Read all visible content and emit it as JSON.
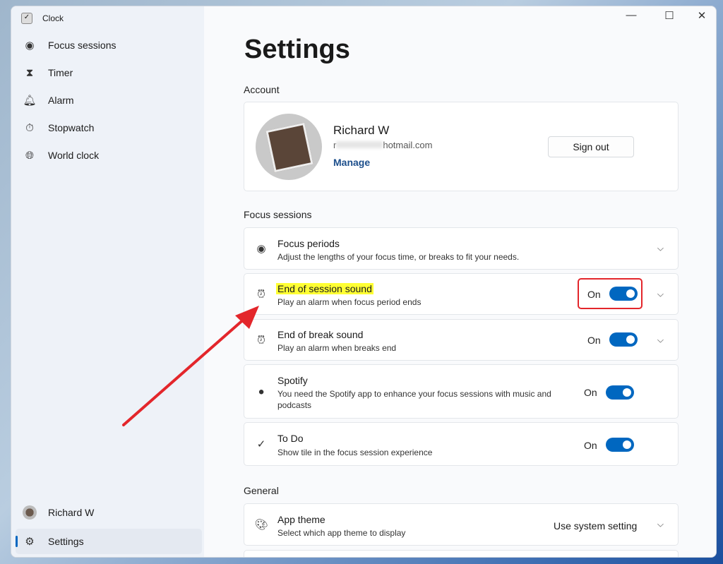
{
  "app": {
    "name": "Clock"
  },
  "sidebar": {
    "items": [
      {
        "label": "Focus sessions",
        "icon": "focus-icon"
      },
      {
        "label": "Timer",
        "icon": "hourglass-icon"
      },
      {
        "label": "Alarm",
        "icon": "bell-icon"
      },
      {
        "label": "Stopwatch",
        "icon": "stopwatch-icon"
      },
      {
        "label": "World clock",
        "icon": "globe-icon"
      }
    ],
    "user": "Richard W",
    "settings": "Settings"
  },
  "page": {
    "title": "Settings"
  },
  "account": {
    "section": "Account",
    "name": "Richard W",
    "email_prefix": "r",
    "email_suffix": "hotmail.com",
    "manage": "Manage",
    "sign_out": "Sign out"
  },
  "focus": {
    "section": "Focus sessions",
    "rows": [
      {
        "title": "Focus periods",
        "desc": "Adjust the lengths of your focus time, or breaks to fit your needs."
      },
      {
        "title": "End of session sound",
        "desc": "Play an alarm when focus period ends",
        "state": "On"
      },
      {
        "title": "End of break sound",
        "desc": "Play an alarm when breaks end",
        "state": "On"
      },
      {
        "title": "Spotify",
        "desc": "You need the Spotify app to enhance your focus sessions with music and podcasts",
        "state": "On"
      },
      {
        "title": "To Do",
        "desc": "Show tile in the focus session experience",
        "state": "On"
      }
    ]
  },
  "general": {
    "section": "General",
    "rows": [
      {
        "title": "App theme",
        "desc": "Select which app theme to display",
        "value": "Use system setting"
      }
    ]
  },
  "colors": {
    "accent": "#0067c0",
    "highlight": "#ffff33",
    "annotation": "#e3262b"
  }
}
